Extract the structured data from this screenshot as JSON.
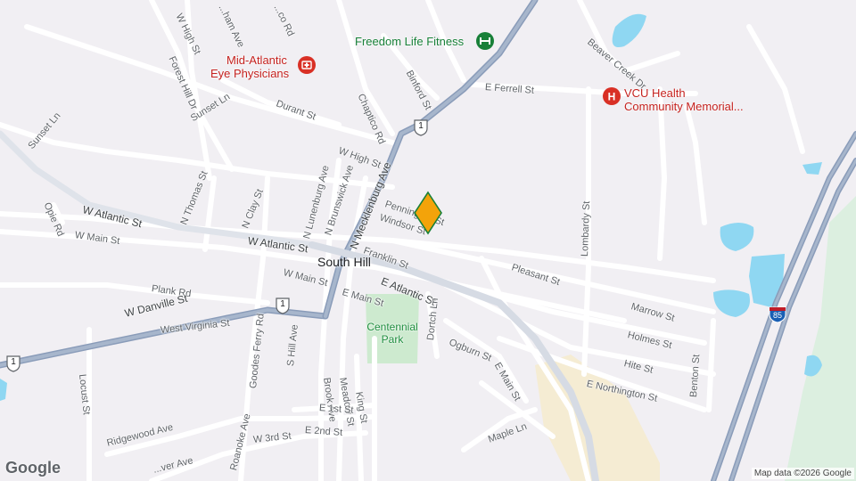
{
  "map": {
    "city_label": "South Hill",
    "attribution": "Map data ©2026 Google",
    "logo": "Google",
    "marker_color": "#f3a30a",
    "colors": {
      "land": "#f1eff3",
      "water": "#8fd7f2",
      "park": "#cdeacf",
      "industrial": "#f5ecd3",
      "road": "#ffffff",
      "highway": "#8a9cb9"
    },
    "pois": {
      "fitness": {
        "name": "Freedom Life Fitness",
        "icon": "gym-icon"
      },
      "eye": {
        "line1": "Mid-Atlantic",
        "line2": "Eye Physicians",
        "icon": "medical-icon"
      },
      "hospital": {
        "line1": "VCU Health",
        "line2": "Community Memorial...",
        "icon": "hospital-icon"
      },
      "park": {
        "line1": "Centennial",
        "line2": "Park"
      }
    },
    "shields": {
      "us1": "1",
      "i85": "85"
    },
    "streets": {
      "w_high_st_top": "W High St",
      "forest_hill_dr": "Forest Hill Dr",
      "sunset_ln": "Sunset Ln",
      "sunset_ln_w": "Sunset Ln",
      "durant_st": "Durant St",
      "chaptico_rd": "Chaptico Rd",
      "binford_st": "Binford St",
      "e_ferrell_st": "E Ferrell St",
      "beaver_creek_dr": "Beaver Creek Dr",
      "w_high_st": "W High St",
      "n_mecklenburg_ave": "N Mecklenburg Ave",
      "n_lunenburg_ave": "N Lunenburg Ave",
      "n_brunswick_ave": "N Brunswick Ave",
      "n_thomas_st": "N Thomas St",
      "n_clay_st": "N Clay St",
      "pennington_st": "Pennington St",
      "windsor_st": "Windsor St",
      "franklin_st": "Franklin St",
      "w_atlantic_st_w": "W Atlantic St",
      "w_atlantic_st": "W Atlantic St",
      "opie_rd": "Opie Rd",
      "w_main_st_w": "W Main St",
      "w_main_st": "W Main St",
      "e_main_st": "E Main St",
      "e_atlantic_st": "E Atlantic St",
      "pleasant_st": "Pleasant St",
      "lombardy_st": "Lombardy St",
      "plank_rd": "Plank Rd",
      "w_danville_st": "W Danville St",
      "west_virginia_st": "West Virginia St",
      "goodes_ferry_rd": "Goodes Ferry Rd",
      "s_hill_ave": "S Hill Ave",
      "brook_ave": "Brook Ave",
      "meadow_st": "Meadow St",
      "king_st": "King St",
      "dortch_ln": "Dortch Ln",
      "ogburn_st": "Ogburn St",
      "e_main_st_s": "E Main St",
      "marrow_st": "Marrow St",
      "holmes_st": "Holmes St",
      "hite_st": "Hite St",
      "e_northington_st": "E Northington St",
      "benton_st": "Benton St",
      "locust_st": "Locust St",
      "e_1st_st": "E 1st St",
      "e_2nd_st": "E 2nd St",
      "w_3rd_st": "W 3rd St",
      "ridgewood_ave": "Ridgewood Ave",
      "roanoke_ave": "Roanoke Ave",
      "maple_ln": "Maple Ln",
      "top_ave": "...ham Ave",
      "top_rd": "...co Rd",
      "bottom_ave": "...ver Ave"
    }
  }
}
